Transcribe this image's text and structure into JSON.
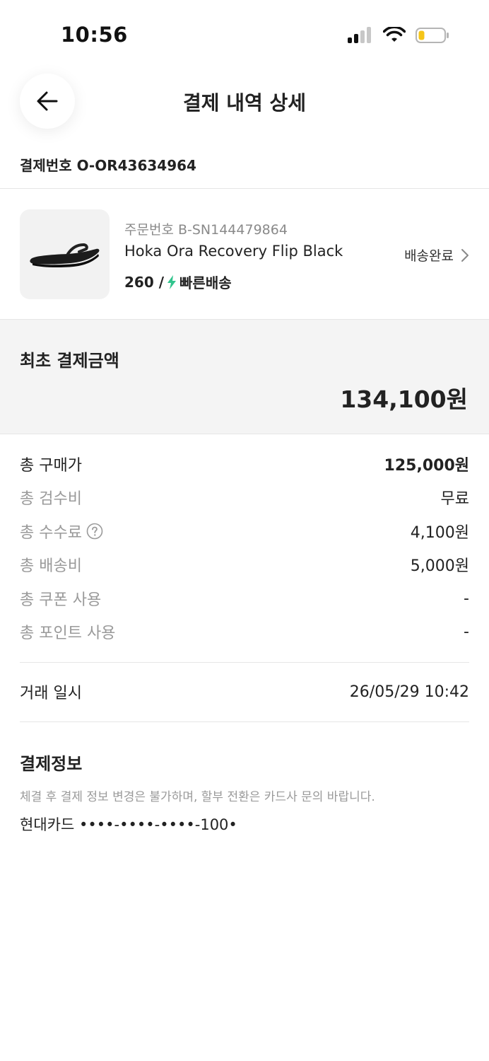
{
  "status_bar": {
    "time": "10:56",
    "icons": [
      "signal-icon",
      "wifi-icon",
      "battery-icon"
    ],
    "battery_color": "#f5c518"
  },
  "header": {
    "back_icon": "arrow-left-icon",
    "title": "결제 내역 상세"
  },
  "payment_number": "결제번호 O-OR43634964",
  "order": {
    "order_number": "주문번호 B-SN144479864",
    "product_name": "Hoka Ora Recovery Flip Black",
    "size_prefix": "260 /",
    "fast_delivery_label": "빠른배송",
    "fast_delivery_color": "#31c48d",
    "status": "배송완료",
    "status_icon": "chevron-right-icon",
    "thumbnail_icon": "sandal-product-image"
  },
  "initial_payment": {
    "label": "최초 결제금액",
    "amount": "134,100원"
  },
  "fees": [
    {
      "label": "총 구매가",
      "value": "125,000원"
    },
    {
      "label": "총 검수비",
      "value": "무료"
    },
    {
      "label": "총 수수료",
      "value": "4,100원"
    },
    {
      "label": "총 배송비",
      "value": "5,000원"
    },
    {
      "label": "총 쿠폰 사용",
      "value": "-"
    },
    {
      "label": "총 포인트 사용",
      "value": "-"
    }
  ],
  "transaction": {
    "label": "거래 일시",
    "value": "26/05/29 10:42"
  },
  "payment_info": {
    "title": "결제정보",
    "notice": "체결 후 결제 정보 변경은 불가하며, 할부 전환은 카드사 문의 바랍니다.",
    "card": "현대카드 ••••-••••-••••-100•"
  }
}
